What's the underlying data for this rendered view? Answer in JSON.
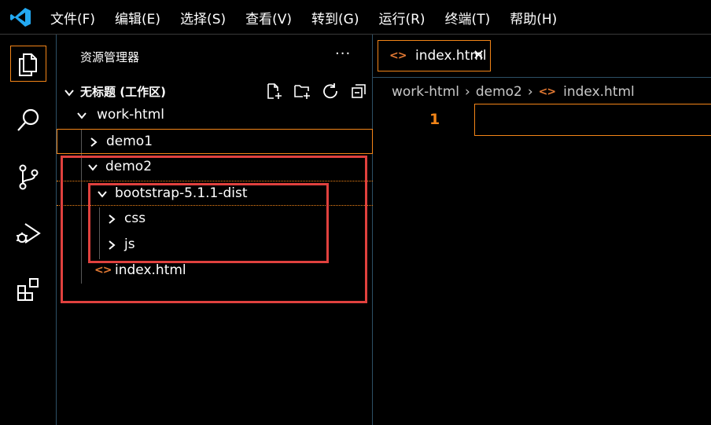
{
  "menu": {
    "items": [
      "文件(F)",
      "编辑(E)",
      "选择(S)",
      "查看(V)",
      "转到(G)",
      "运行(R)",
      "终端(T)",
      "帮助(H)"
    ]
  },
  "activity_bar": {
    "icons": [
      "explorer-icon",
      "search-icon",
      "source-control-icon",
      "run-debug-icon",
      "extensions-icon"
    ]
  },
  "sidebar": {
    "header": "资源管理器",
    "more": "···",
    "workspace_title": "无标题 (工作区)",
    "tree": {
      "work_html": "work-html",
      "demo1": "demo1",
      "demo2": "demo2",
      "bootstrap": "bootstrap-5.1.1-dist",
      "css": "css",
      "js": "js",
      "index_html": "index.html"
    }
  },
  "editor": {
    "tab_title": "index.html",
    "close_glyph": "✕",
    "file_icon": "<>",
    "breadcrumb": [
      "work-html",
      "demo2",
      "index.html"
    ],
    "line_number": "1"
  },
  "colors": {
    "focus_border": "#f38518",
    "highlight_box": "#e0413e",
    "html_icon": "#e37933",
    "vscode_blue": "#23a9f2"
  }
}
